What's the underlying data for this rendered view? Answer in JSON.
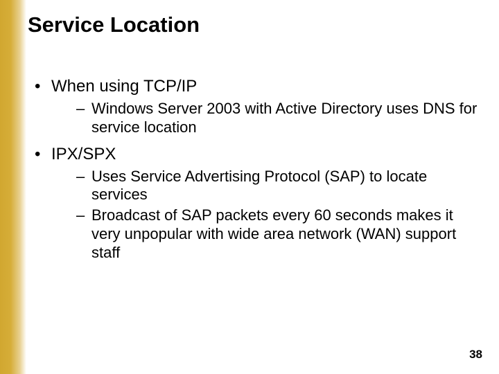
{
  "title": "Service Location",
  "bullets": [
    {
      "text": "When using TCP/IP",
      "subs": [
        "Windows Server 2003 with Active Directory uses DNS for service location"
      ]
    },
    {
      "text": "IPX/SPX",
      "subs": [
        "Uses Service Advertising Protocol (SAP) to locate services",
        "Broadcast of SAP packets every 60 seconds makes it very unpopular with wide area network (WAN) support staff"
      ]
    }
  ],
  "page_number": "38"
}
